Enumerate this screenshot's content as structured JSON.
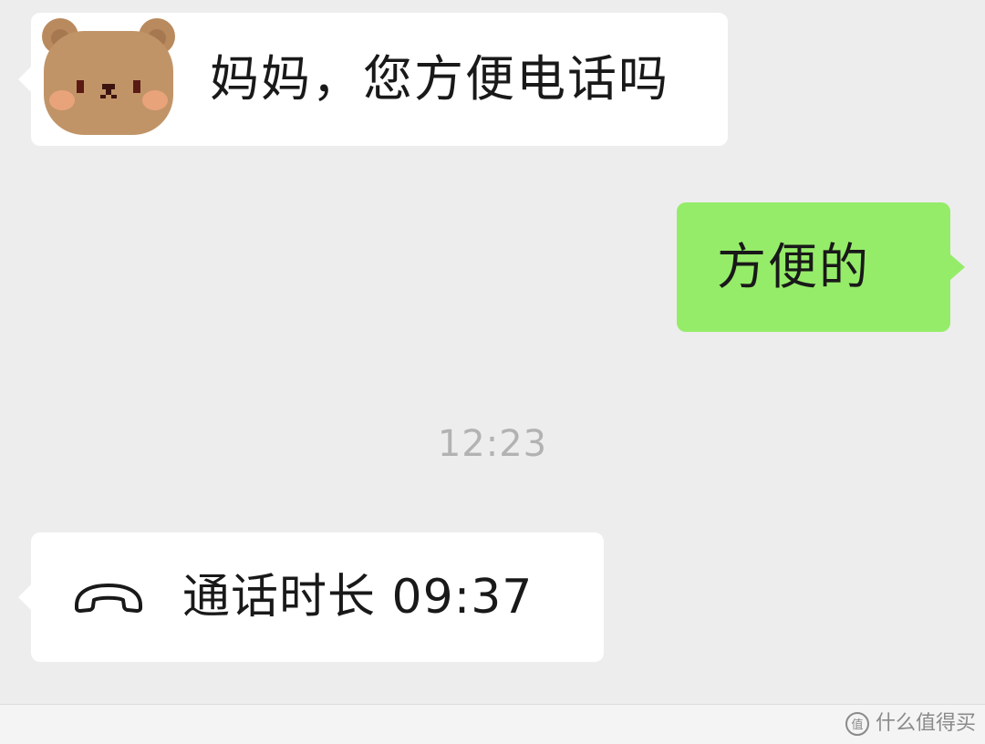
{
  "messages": [
    {
      "id": "msg1",
      "direction": "incoming",
      "text": "妈妈，您方便电话吗"
    },
    {
      "id": "msg2",
      "direction": "outgoing",
      "text": "方便的"
    },
    {
      "id": "msg3",
      "direction": "incoming",
      "type": "call-record",
      "icon": "phone-hangup-icon",
      "text": "通话时长 09:37"
    }
  ],
  "timestamp": "12:23",
  "avatar": {
    "icon": "bear-avatar"
  },
  "watermark": {
    "icon": "watermark-logo-icon",
    "text": "什么值得买"
  },
  "colors": {
    "chat_background": "#ededed",
    "incoming_bubble": "#ffffff",
    "outgoing_bubble": "#95ec69",
    "timestamp_text": "#b2b2b2",
    "message_text": "#191919"
  }
}
